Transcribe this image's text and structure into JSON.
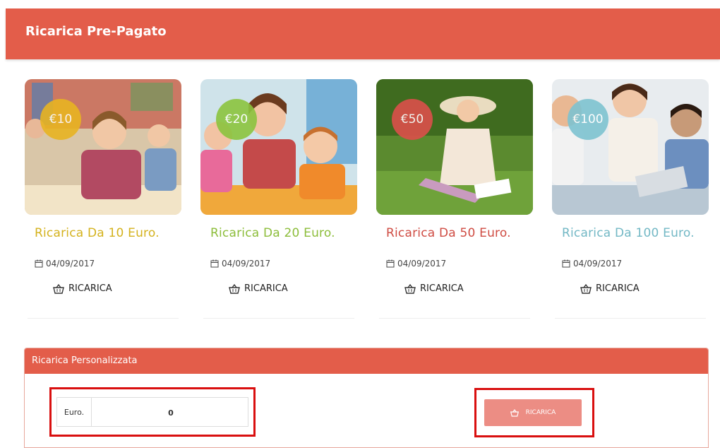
{
  "header": {
    "title": "Ricarica Pre-Pagato"
  },
  "cards": [
    {
      "price": "€10",
      "title": "Ricarica Da 10 Euro.",
      "date": "04/09/2017",
      "button": "RICARICA",
      "accent": "#d4b21d",
      "badge": "#e8b422"
    },
    {
      "price": "€20",
      "title": "Ricarica Da 20 Euro.",
      "date": "04/09/2017",
      "button": "RICARICA",
      "accent": "#8cbd3a",
      "badge": "#8cc43f"
    },
    {
      "price": "€50",
      "title": "Ricarica Da 50 Euro.",
      "date": "04/09/2017",
      "button": "RICARICA",
      "accent": "#cf4b42",
      "badge": "#d9504a"
    },
    {
      "price": "€100",
      "title": "Ricarica Da 100 Euro.",
      "date": "04/09/2017",
      "button": "RICARICA",
      "accent": "#73b8c5",
      "badge": "#7ec3d1"
    }
  ],
  "custom": {
    "title": "Ricarica Personalizzata",
    "euro_label": "Euro.",
    "euro_value": "0",
    "button": "RICARICA"
  },
  "colors": {
    "header": "#e35d4a",
    "highlight_box": "#d90f0f",
    "submit_button": "#ec8d84"
  },
  "icons": {
    "date": "calendar-icon",
    "button": "basket-icon"
  }
}
